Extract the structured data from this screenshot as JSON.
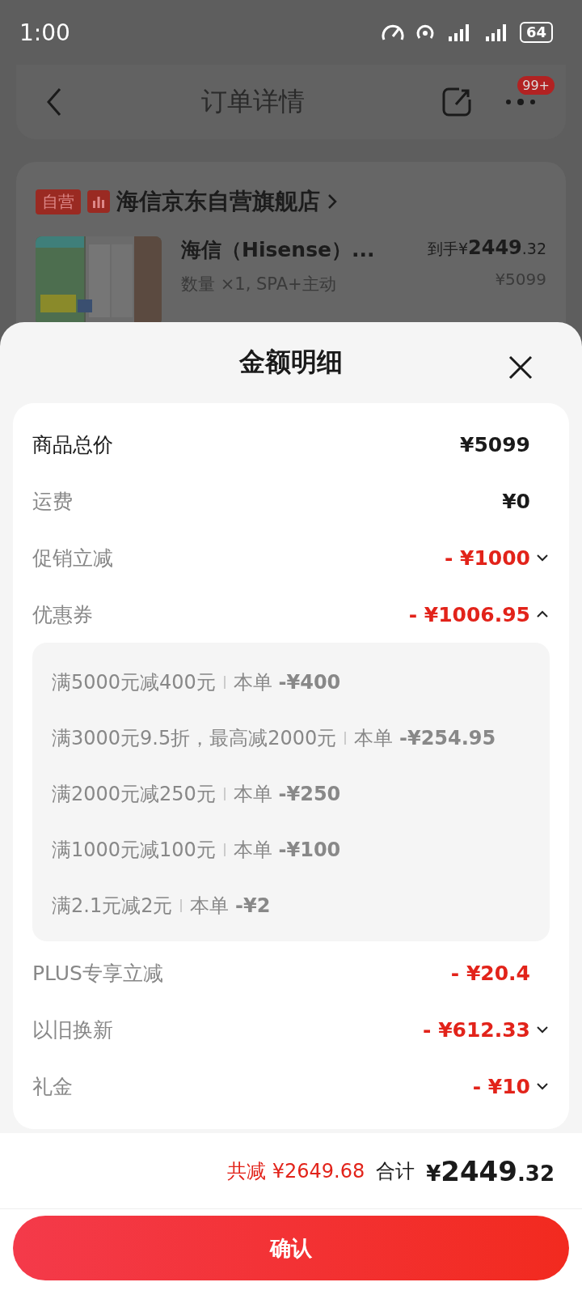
{
  "status_bar": {
    "time": "1:00",
    "battery": "64"
  },
  "header": {
    "title": "订单详情",
    "badge": "99+"
  },
  "store": {
    "tag": "自营",
    "name": "海信京东自营旗舰店"
  },
  "product": {
    "kind": "picture",
    "title": "海信（Hisense）...",
    "spec": "数量 ×1, SPA+主动",
    "price_prefix": "到手¥",
    "price_main": "2449",
    "price_cents": ".32",
    "original_price": "¥5099"
  },
  "sheet": {
    "title": "金额明细",
    "rows": [
      {
        "kind": "total",
        "label": "商品总价",
        "value": "¥5099"
      },
      {
        "kind": "fee",
        "label": "运费",
        "value": "¥0"
      },
      {
        "kind": "discount",
        "label": "促销立减",
        "value": "- ¥1000",
        "expanded": false
      },
      {
        "kind": "discount",
        "label": "优惠券",
        "value": "- ¥1006.95",
        "expanded": true,
        "details": [
          {
            "condition": "满5000元减400元",
            "amount": "本单 **-¥400**"
          },
          {
            "condition": "满3000元9.5折，最高减2000元",
            "amount": "本单 **-¥254.95**"
          },
          {
            "condition": "满2000元减250元",
            "amount": "本单 **-¥250**"
          },
          {
            "condition": "满1000元减100元",
            "amount": "本单 **-¥100**"
          },
          {
            "condition": "满2.1元减2元",
            "amount": "本单 **-¥2**"
          }
        ]
      },
      {
        "kind": "discount",
        "label": "PLUS专享立减",
        "value": "- ¥20.4"
      },
      {
        "kind": "discount",
        "label": "以旧换新",
        "value": "- ¥612.33",
        "expanded": false
      },
      {
        "kind": "discount",
        "label": "礼金",
        "value": "- ¥10",
        "expanded": false
      }
    ]
  },
  "footer": {
    "saved": "共减 ¥2649.68",
    "total_label": "合计",
    "currency": "¥",
    "total_main": "2449",
    "total_cents": ".32",
    "confirm": "确认"
  }
}
